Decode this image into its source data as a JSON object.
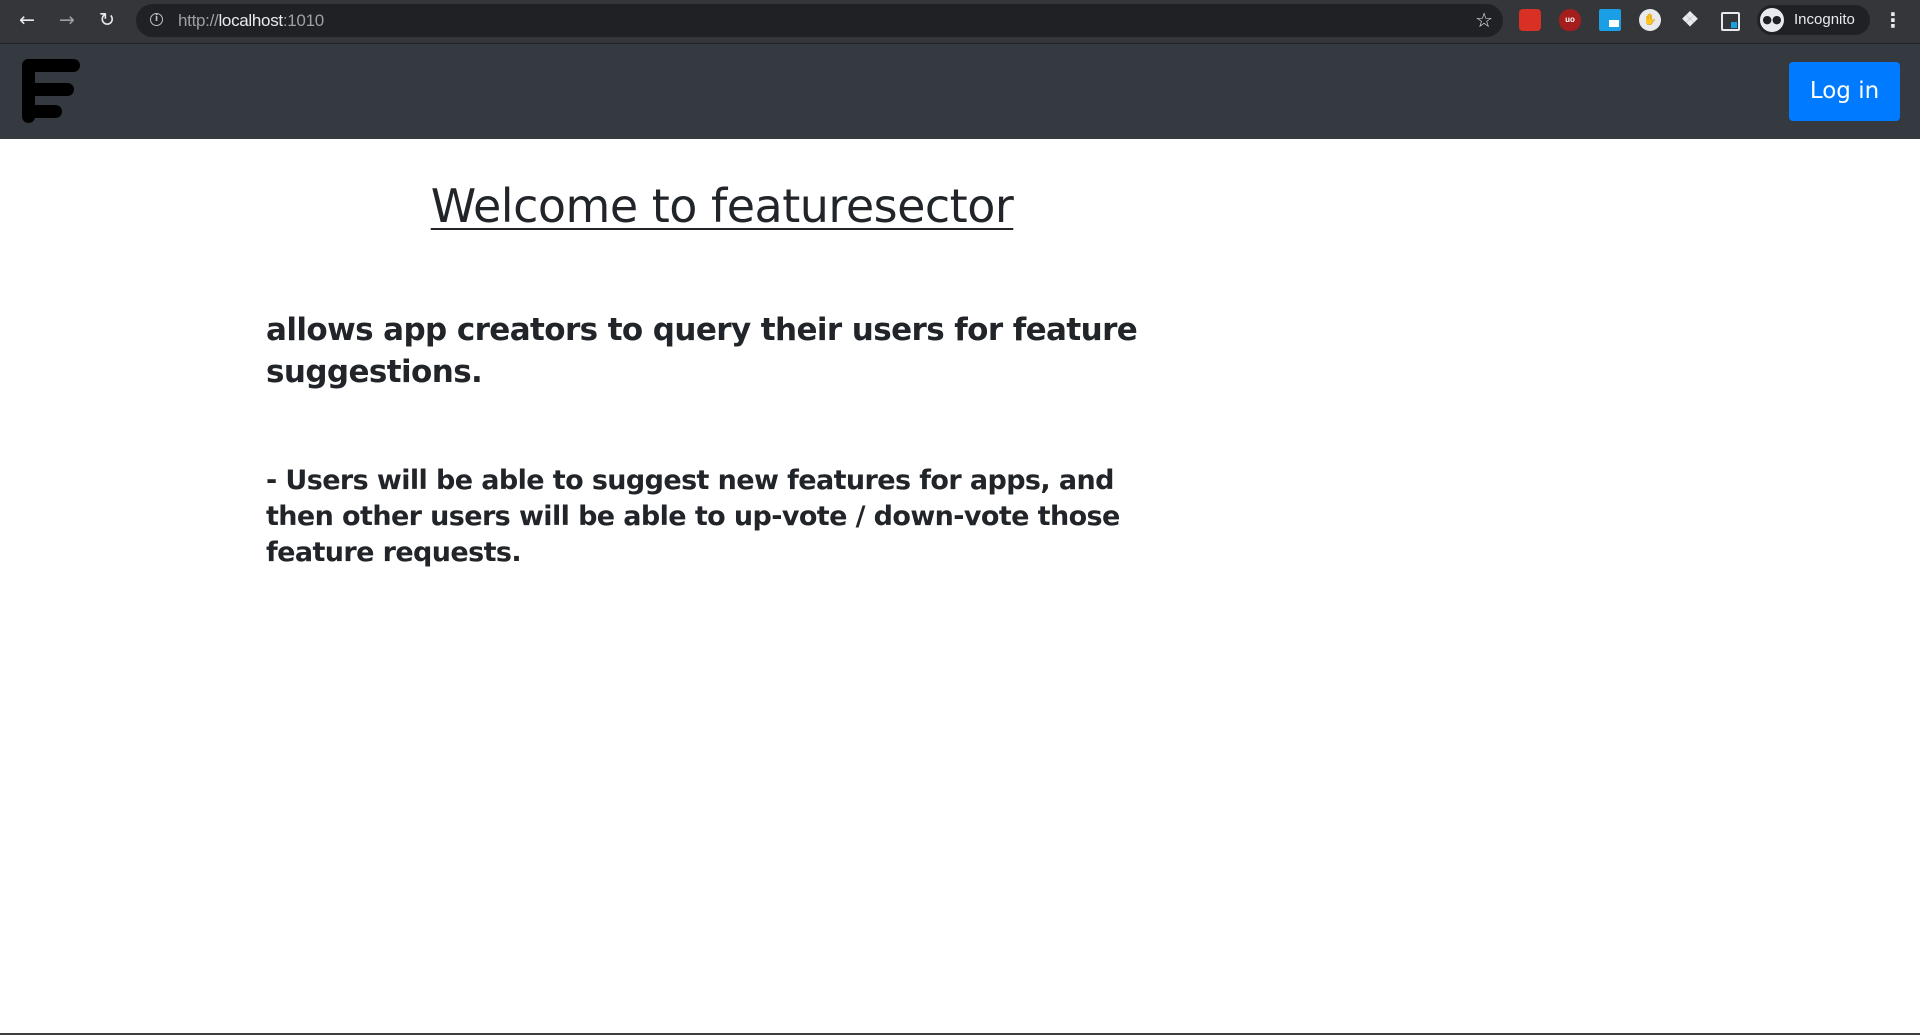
{
  "browser": {
    "url_scheme": "http://",
    "url_host": "localhost",
    "url_port": ":1010",
    "profile_label": "Incognito",
    "extension_1_text": "",
    "extension_2_text": "uo",
    "icons": [
      "back-icon",
      "forward-icon",
      "reload-icon",
      "info-icon",
      "star-icon",
      "puzzle-icon",
      "menu-icon"
    ]
  },
  "navbar": {
    "login_label": "Log in"
  },
  "main": {
    "title": "Welcome to featuresector",
    "intro": "allows app creators to query their users for feature suggestions.",
    "feature_point": "- Users will be able to suggest new features for apps, and then other users will be able to up-vote / down-vote those feature requests."
  },
  "colors": {
    "navbar_bg": "#343a40",
    "primary_button": "#007bff",
    "text": "#212529"
  }
}
